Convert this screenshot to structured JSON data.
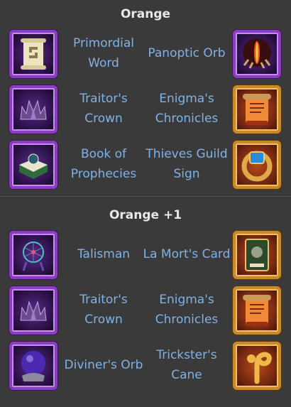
{
  "sections": [
    {
      "title": "Orange",
      "rows": [
        {
          "left": {
            "name": "Primordial Word",
            "icon": "scroll-icon"
          },
          "right": {
            "name": "Panoptic Orb",
            "icon": "eye-orb-icon"
          }
        },
        {
          "left": {
            "name": "Traitor's Crown",
            "icon": "crown-icon"
          },
          "right": {
            "name": "Enigma's Chronicles",
            "icon": "scroll-fire-icon"
          }
        },
        {
          "left": {
            "name": "Book of Prophecies",
            "icon": "book-icon"
          },
          "right": {
            "name": "Thieves Guild Sign",
            "icon": "ring-icon"
          }
        }
      ]
    },
    {
      "title": "Orange +1",
      "rows": [
        {
          "left": {
            "name": "Talisman",
            "icon": "dreamcatcher-icon"
          },
          "right": {
            "name": "La Mort's Card",
            "icon": "tarot-card-icon"
          }
        },
        {
          "left": {
            "name": "Traitor's Crown",
            "icon": "crown-icon"
          },
          "right": {
            "name": "Enigma's Chronicles",
            "icon": "scroll-fire-icon"
          }
        },
        {
          "left": {
            "name": "Diviner's Orb",
            "icon": "crystal-orb-icon"
          },
          "right": {
            "name": "Trickster's Cane",
            "icon": "cane-icon"
          }
        }
      ]
    }
  ],
  "colors": {
    "background": "#3a3a3a",
    "title": "#e8e8e8",
    "label": "#7fb2e6",
    "purple_frame": "#8a3fc0",
    "gold_frame": "#c9882a"
  }
}
